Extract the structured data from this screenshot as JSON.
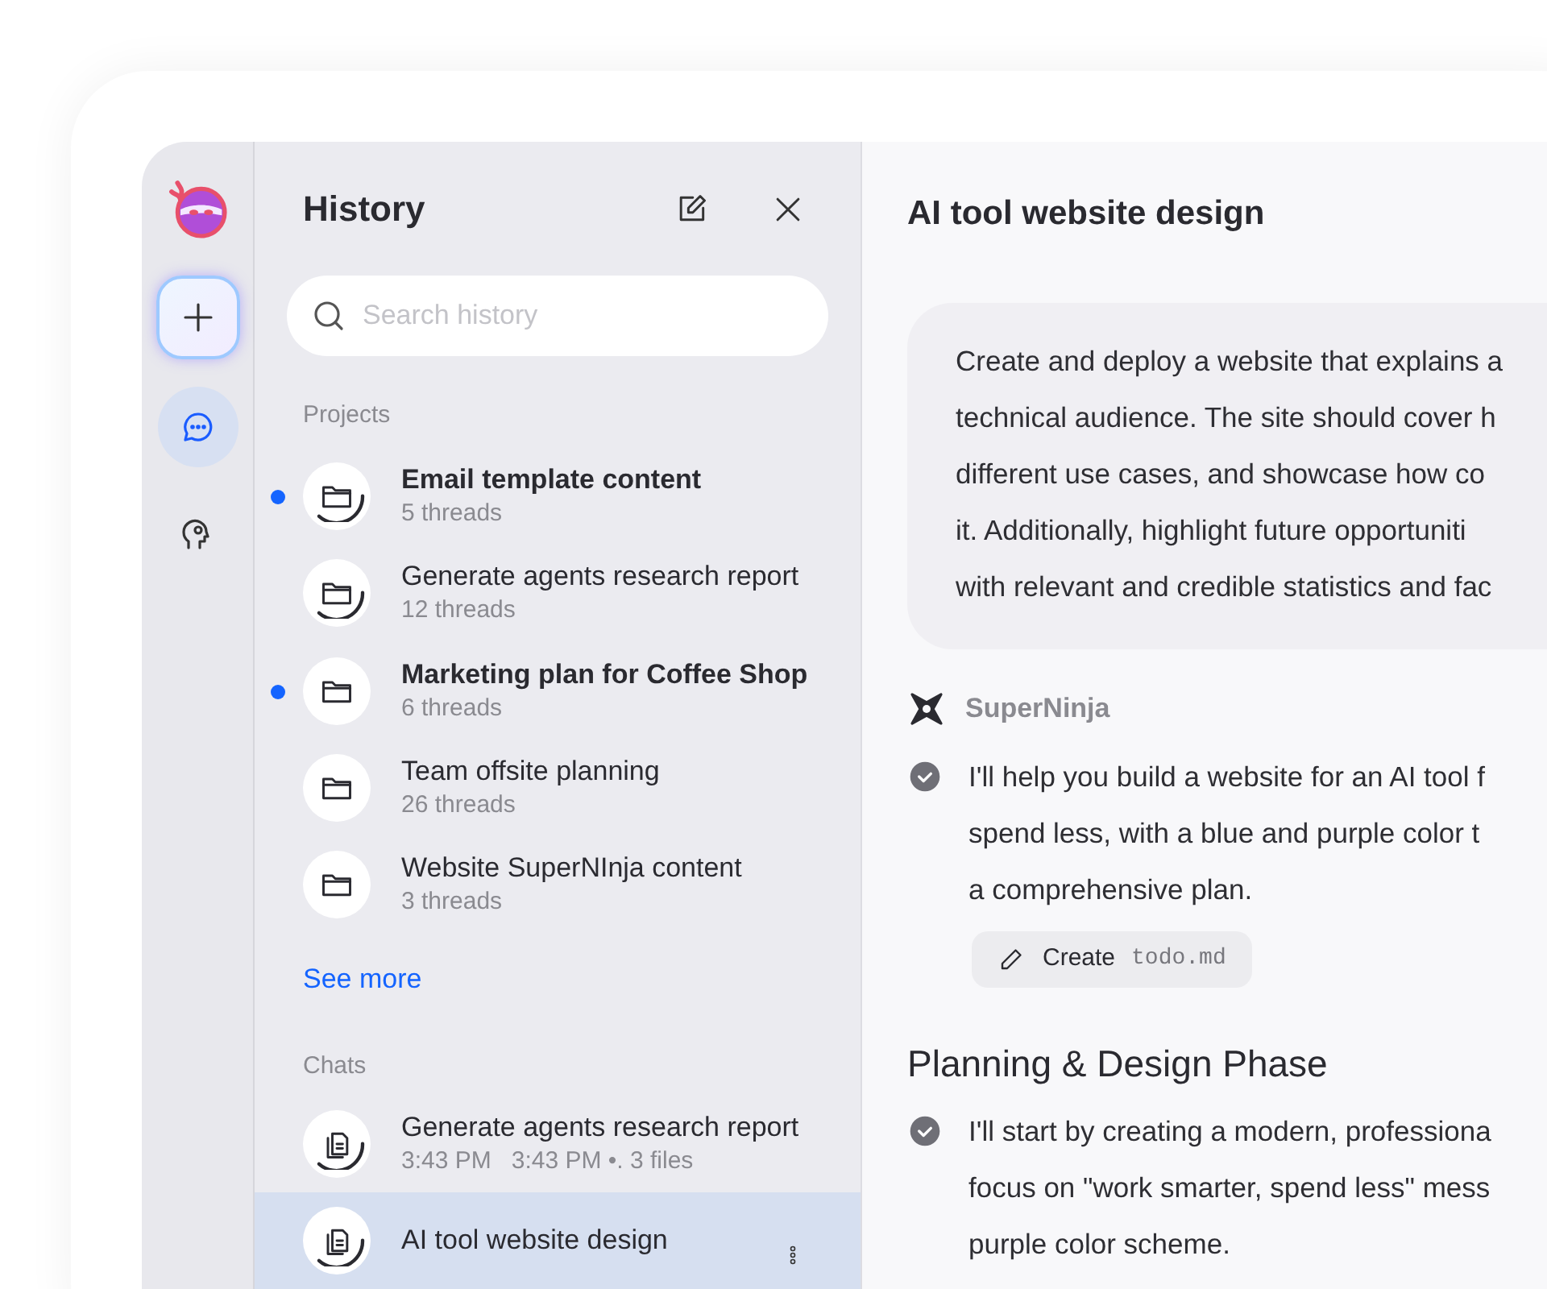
{
  "rail": {
    "items": [
      {
        "kind": "new",
        "selected": false
      },
      {
        "kind": "chats",
        "selected": true
      },
      {
        "kind": "agents",
        "selected": false
      }
    ]
  },
  "history": {
    "title": "History",
    "search": {
      "placeholder": "Search history"
    },
    "projects": {
      "heading": "Projects",
      "items": [
        {
          "title": "Email template content",
          "meta": "5 threads",
          "unread": true,
          "ring": true
        },
        {
          "title": "Generate agents research report",
          "meta": "12 threads",
          "unread": false,
          "ring": true
        },
        {
          "title": "Marketing plan for Coffee Shop",
          "meta": "6 threads",
          "unread": true,
          "ring": false
        },
        {
          "title": "Team offsite planning",
          "meta": "26 threads",
          "unread": false,
          "ring": false
        },
        {
          "title": "Website SuperNInja content",
          "meta": "3 threads",
          "unread": false,
          "ring": false
        }
      ],
      "see_more": "See more"
    },
    "chats": {
      "heading": "Chats",
      "items": [
        {
          "title": "Generate agents research report",
          "meta": "3:43 PM   3:43 PM •. 3 files",
          "selected": false
        },
        {
          "title": "AI tool website design",
          "selected": true
        }
      ]
    }
  },
  "conversation": {
    "title": "AI tool website design",
    "prompt_lines": [
      "Create and deploy a website that explains a",
      "technical audience. The site should cover h",
      "different use cases, and showcase how co",
      "it. Additionally, highlight future opportuniti",
      "with relevant and credible statistics and fac"
    ],
    "assistant": "SuperNinja",
    "steps": [
      {
        "kind": "message",
        "lines": [
          "I'll help you build a website for an AI tool f",
          "spend less, with a blue and purple color t",
          "a comprehensive plan."
        ]
      },
      {
        "kind": "action",
        "verb": "Create",
        "file": "todo.md"
      },
      {
        "kind": "heading",
        "text": "Planning & Design Phase"
      },
      {
        "kind": "message",
        "lines": [
          "I'll start by creating a modern, professiona",
          "focus on \"work smarter, spend less\" mess",
          "purple color scheme."
        ]
      }
    ]
  }
}
